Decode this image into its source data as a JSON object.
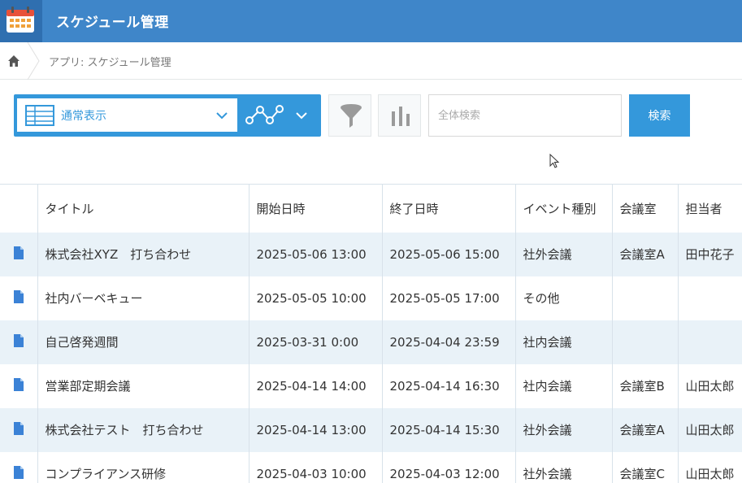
{
  "app": {
    "title": "スケジュール管理"
  },
  "breadcrumb": {
    "text": "アプリ: スケジュール管理"
  },
  "toolbar": {
    "view_label": "通常表示",
    "search_placeholder": "全体検索",
    "search_button": "検索"
  },
  "colors": {
    "header": "#3f86c9",
    "accent": "#3498db",
    "row_alt": "#e9f2f8"
  },
  "table": {
    "columns": [
      "タイトル",
      "開始日時",
      "終了日時",
      "イベント種別",
      "会議室",
      "担当者"
    ],
    "rows": [
      [
        "株式会社XYZ　打ち合わせ",
        "2025-05-06 13:00",
        "2025-05-06 15:00",
        "社外会議",
        "会議室A",
        "田中花子"
      ],
      [
        "社内バーベキュー",
        "2025-05-05 10:00",
        "2025-05-05 17:00",
        "その他",
        "",
        ""
      ],
      [
        "自己啓発週間",
        "2025-03-31 0:00",
        "2025-04-04 23:59",
        "社内会議",
        "",
        ""
      ],
      [
        "営業部定期会議",
        "2025-04-14 14:00",
        "2025-04-14 16:30",
        "社内会議",
        "会議室B",
        "山田太郎"
      ],
      [
        "株式会社テスト　打ち合わせ",
        "2025-04-14 13:00",
        "2025-04-14 15:30",
        "社外会議",
        "会議室A",
        "山田太郎"
      ],
      [
        "コンプライアンス研修",
        "2025-04-03 10:00",
        "2025-04-03 12:00",
        "社外会議",
        "会議室C",
        "山田太郎"
      ]
    ]
  }
}
